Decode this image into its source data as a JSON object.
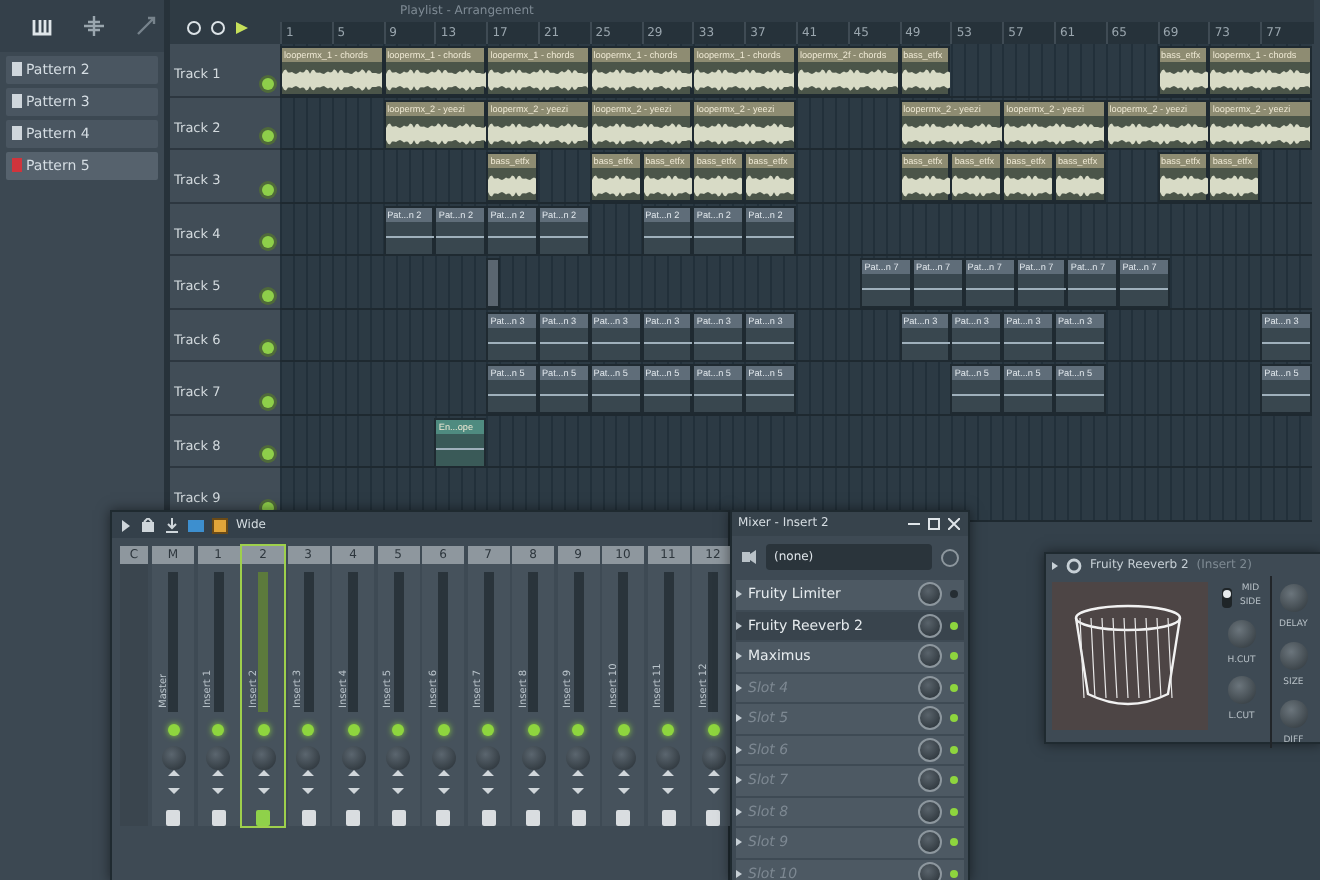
{
  "title_bar": {
    "title": "Playlist - Arrangement"
  },
  "patterns": [
    {
      "label": "Pattern 2",
      "selected": false
    },
    {
      "label": "Pattern 3",
      "selected": false
    },
    {
      "label": "Pattern 4",
      "selected": false
    },
    {
      "label": "Pattern 5",
      "selected": true
    }
  ],
  "ruler": [
    "1",
    "5",
    "9",
    "13",
    "17",
    "21",
    "25",
    "29",
    "33",
    "37",
    "41",
    "45",
    "49",
    "53",
    "57",
    "61",
    "65",
    "69",
    "73",
    "77"
  ],
  "tracks": [
    {
      "name": "Track 1",
      "lane": [
        {
          "kind": "loop",
          "label": "loopermx_1 - chords"
        },
        {
          "kind": "loop",
          "label": "loopermx_1 - chords"
        },
        {
          "kind": "loop",
          "label": "loopermx_1 - chords"
        },
        {
          "kind": "loop",
          "label": "loopermx_1 - chords"
        },
        {
          "kind": "loop",
          "label": "loopermx_1 - chords"
        },
        {
          "kind": "loop",
          "label": "loopermx_2f - chords"
        },
        {
          "kind": "sample",
          "label": "bass_etfx"
        },
        {
          "kind": "gap"
        },
        {
          "kind": "gap"
        },
        {
          "kind": "gap"
        },
        {
          "kind": "gap"
        },
        {
          "kind": "sample",
          "label": "bass_etfx"
        },
        {
          "kind": "loop",
          "label": "loopermx_1 - chords"
        }
      ]
    },
    {
      "name": "Track 2",
      "lane": [
        {
          "kind": "gap"
        },
        {
          "kind": "gap"
        },
        {
          "kind": "loop",
          "label": "loopermx_2 - yeezi"
        },
        {
          "kind": "loop",
          "label": "loopermx_2 - yeezi"
        },
        {
          "kind": "loop",
          "label": "loopermx_2 - yeezi"
        },
        {
          "kind": "loop",
          "label": "loopermx_2 - yeezi"
        },
        {
          "kind": "gap"
        },
        {
          "kind": "gap"
        },
        {
          "kind": "loop",
          "label": "loopermx_2 - yeezi"
        },
        {
          "kind": "loop",
          "label": "loopermx_2 - yeezi"
        },
        {
          "kind": "loop",
          "label": "loopermx_2 - yeezi"
        },
        {
          "kind": "loop",
          "label": "loopermx_2 - yeezi"
        }
      ]
    },
    {
      "name": "Track 3",
      "lane": [
        {
          "kind": "gap"
        },
        {
          "kind": "gap"
        },
        {
          "kind": "gap"
        },
        {
          "kind": "gap"
        },
        {
          "kind": "sample",
          "label": "bass_etfx"
        },
        {
          "kind": "gap"
        },
        {
          "kind": "sample",
          "label": "bass_etfx"
        },
        {
          "kind": "sample",
          "label": "bass_etfx"
        },
        {
          "kind": "sample",
          "label": "bass_etfx"
        },
        {
          "kind": "sample",
          "label": "bass_etfx"
        },
        {
          "kind": "gap"
        },
        {
          "kind": "gap"
        },
        {
          "kind": "sample",
          "label": "bass_etfx"
        },
        {
          "kind": "sample",
          "label": "bass_etfx"
        },
        {
          "kind": "sample",
          "label": "bass_etfx"
        },
        {
          "kind": "sample",
          "label": "bass_etfx"
        },
        {
          "kind": "gap"
        },
        {
          "kind": "sample",
          "label": "bass_etfx"
        },
        {
          "kind": "sample",
          "label": "bass_etfx"
        }
      ]
    },
    {
      "name": "Track 4",
      "lane": [
        {
          "kind": "gap"
        },
        {
          "kind": "gap"
        },
        {
          "kind": "pattern",
          "label": "Pat...n 2"
        },
        {
          "kind": "pattern",
          "label": "Pat...n 2"
        },
        {
          "kind": "pattern",
          "label": "Pat...n 2"
        },
        {
          "kind": "pattern",
          "label": "Pat...n 2"
        },
        {
          "kind": "gap"
        },
        {
          "kind": "pattern",
          "label": "Pat...n 2"
        },
        {
          "kind": "pattern",
          "label": "Pat...n 2"
        },
        {
          "kind": "pattern",
          "label": "Pat...n 2"
        }
      ]
    },
    {
      "name": "Track 5",
      "lane": [
        {
          "kind": "gap"
        },
        {
          "kind": "gap"
        },
        {
          "kind": "gap"
        },
        {
          "kind": "gap"
        },
        {
          "kind": "marker"
        },
        {
          "kind": "gap"
        },
        {
          "kind": "gap"
        },
        {
          "kind": "gap"
        },
        {
          "kind": "gap"
        },
        {
          "kind": "gap"
        },
        {
          "kind": "gap"
        },
        {
          "kind": "gap"
        },
        {
          "kind": "pattern",
          "label": "Pat...n 7"
        },
        {
          "kind": "pattern",
          "label": "Pat...n 7"
        },
        {
          "kind": "pattern",
          "label": "Pat...n 7"
        },
        {
          "kind": "pattern",
          "label": "Pat...n 7"
        },
        {
          "kind": "pattern",
          "label": "Pat...n 7"
        },
        {
          "kind": "pattern",
          "label": "Pat...n 7"
        }
      ]
    },
    {
      "name": "Track 6",
      "lane": [
        {
          "kind": "gap"
        },
        {
          "kind": "gap"
        },
        {
          "kind": "gap"
        },
        {
          "kind": "gap"
        },
        {
          "kind": "pattern",
          "label": "Pat...n 3"
        },
        {
          "kind": "pattern",
          "label": "Pat...n 3"
        },
        {
          "kind": "pattern",
          "label": "Pat...n 3"
        },
        {
          "kind": "pattern",
          "label": "Pat...n 3"
        },
        {
          "kind": "pattern",
          "label": "Pat...n 3"
        },
        {
          "kind": "pattern",
          "label": "Pat...n 3"
        },
        {
          "kind": "gap"
        },
        {
          "kind": "gap"
        },
        {
          "kind": "pattern",
          "label": "Pat...n 3"
        },
        {
          "kind": "pattern",
          "label": "Pat...n 3"
        },
        {
          "kind": "pattern",
          "label": "Pat...n 3"
        },
        {
          "kind": "pattern",
          "label": "Pat...n 3"
        },
        {
          "kind": "gap"
        },
        {
          "kind": "gap"
        },
        {
          "kind": "gap"
        },
        {
          "kind": "pattern",
          "label": "Pat...n 3"
        }
      ]
    },
    {
      "name": "Track 7",
      "lane": [
        {
          "kind": "gap"
        },
        {
          "kind": "gap"
        },
        {
          "kind": "gap"
        },
        {
          "kind": "gap"
        },
        {
          "kind": "pattern",
          "label": "Pat...n 5"
        },
        {
          "kind": "pattern",
          "label": "Pat...n 5"
        },
        {
          "kind": "pattern",
          "label": "Pat...n 5"
        },
        {
          "kind": "pattern",
          "label": "Pat...n 5"
        },
        {
          "kind": "pattern",
          "label": "Pat...n 5"
        },
        {
          "kind": "pattern",
          "label": "Pat...n 5"
        },
        {
          "kind": "gap"
        },
        {
          "kind": "gap"
        },
        {
          "kind": "gap"
        },
        {
          "kind": "pattern",
          "label": "Pat...n 5"
        },
        {
          "kind": "pattern",
          "label": "Pat...n 5"
        },
        {
          "kind": "pattern",
          "label": "Pat...n 5"
        },
        {
          "kind": "gap"
        },
        {
          "kind": "gap"
        },
        {
          "kind": "gap"
        },
        {
          "kind": "pattern",
          "label": "Pat...n 5"
        }
      ]
    },
    {
      "name": "Track 8",
      "lane": [
        {
          "kind": "gap"
        },
        {
          "kind": "gap"
        },
        {
          "kind": "gap"
        },
        {
          "kind": "automation",
          "label": "En...ope"
        }
      ]
    },
    {
      "name": "Track 9"
    }
  ],
  "mixer": {
    "preset": "Wide",
    "scale_label": "C",
    "strips": [
      {
        "number": "M",
        "name": "Master",
        "selected": false
      },
      {
        "number": "1",
        "name": "Insert 1",
        "selected": false
      },
      {
        "number": "2",
        "name": "Insert 2",
        "selected": true
      },
      {
        "number": "3",
        "name": "Insert 3",
        "selected": false
      },
      {
        "number": "4",
        "name": "Insert 4",
        "selected": false
      },
      {
        "number": "5",
        "name": "Insert 5",
        "selected": false
      },
      {
        "number": "6",
        "name": "Insert 6",
        "selected": false
      },
      {
        "number": "7",
        "name": "Insert 7",
        "selected": false
      },
      {
        "number": "8",
        "name": "Insert 8",
        "selected": false
      },
      {
        "number": "9",
        "name": "Insert 9",
        "selected": false
      },
      {
        "number": "10",
        "name": "Insert 10",
        "selected": false
      },
      {
        "number": "11",
        "name": "Insert 11",
        "selected": false
      },
      {
        "number": "12",
        "name": "Insert 12",
        "selected": false
      }
    ]
  },
  "insert": {
    "title": "Mixer - Insert 2",
    "input": "(none)",
    "slots": [
      {
        "label": "Fruity Limiter",
        "kind": "effect",
        "selected": false,
        "enabled": false
      },
      {
        "label": "Fruity Reeverb 2",
        "kind": "effect",
        "selected": true,
        "enabled": true
      },
      {
        "label": "Maximus",
        "kind": "effect",
        "selected": false,
        "enabled": true
      },
      {
        "label": "Slot 4",
        "kind": "empty",
        "selected": false,
        "enabled": true
      },
      {
        "label": "Slot 5",
        "kind": "empty",
        "selected": false,
        "enabled": true
      },
      {
        "label": "Slot 6",
        "kind": "empty",
        "selected": false,
        "enabled": true
      },
      {
        "label": "Slot 7",
        "kind": "empty",
        "selected": false,
        "enabled": true
      },
      {
        "label": "Slot 8",
        "kind": "empty",
        "selected": false,
        "enabled": true
      },
      {
        "label": "Slot 9",
        "kind": "empty",
        "selected": false,
        "enabled": true
      },
      {
        "label": "Slot 10",
        "kind": "empty",
        "selected": false,
        "enabled": true
      }
    ]
  },
  "plugin": {
    "title": "Fruity Reeverb 2",
    "subtitle": "(Insert 2)",
    "mode_options": [
      "MID",
      "SIDE"
    ],
    "left_knobs": [
      "H.CUT",
      "L.CUT"
    ],
    "right_knobs": [
      "DELAY",
      "SIZE",
      "DIFF"
    ]
  }
}
